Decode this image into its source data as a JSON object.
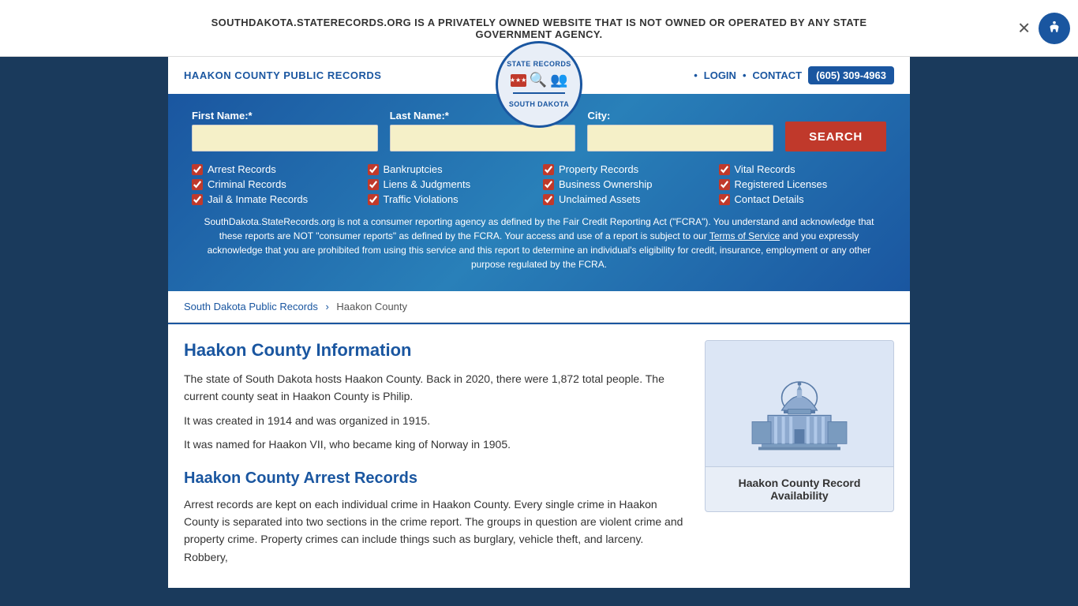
{
  "banner": {
    "text": "SOUTHDAKOTA.STATERECORDS.ORG IS A PRIVATELY OWNED WEBSITE THAT IS NOT OWNED OR OPERATED BY ANY STATE GOVERNMENT AGENCY."
  },
  "header": {
    "site_title": "HAAKON COUNTY PUBLIC RECORDS",
    "logo_top": "STATE RECORDS",
    "logo_bottom": "SOUTH DAKOTA",
    "nav": {
      "login": "LOGIN",
      "contact": "CONTACT",
      "phone": "(605) 309-4963"
    }
  },
  "search": {
    "first_name_label": "First Name:*",
    "last_name_label": "Last Name:*",
    "city_label": "City:",
    "search_button": "SEARCH",
    "checkboxes": [
      {
        "label": "Arrest Records",
        "checked": true
      },
      {
        "label": "Bankruptcies",
        "checked": true
      },
      {
        "label": "Property Records",
        "checked": true
      },
      {
        "label": "Vital Records",
        "checked": true
      },
      {
        "label": "Criminal Records",
        "checked": true
      },
      {
        "label": "Liens & Judgments",
        "checked": true
      },
      {
        "label": "Business Ownership",
        "checked": true
      },
      {
        "label": "Registered Licenses",
        "checked": true
      },
      {
        "label": "Jail & Inmate Records",
        "checked": true
      },
      {
        "label": "Traffic Violations",
        "checked": true
      },
      {
        "label": "Unclaimed Assets",
        "checked": true
      },
      {
        "label": "Contact Details",
        "checked": true
      }
    ],
    "disclaimer": "SouthDakota.StateRecords.org is not a consumer reporting agency as defined by the Fair Credit Reporting Act (\"FCRA\"). You understand and acknowledge that these reports are NOT \"consumer reports\" as defined by the FCRA. Your access and use of a report is subject to our Terms of Service and you expressly acknowledge that you are prohibited from using this service and this report to determine an individual's eligibility for credit, insurance, employment or any other purpose regulated by the FCRA."
  },
  "breadcrumb": {
    "link_text": "South Dakota Public Records",
    "separator": "›",
    "current": "Haakon County"
  },
  "main": {
    "section1_title": "Haakon County Information",
    "section1_para1": "The state of South Dakota hosts Haakon County. Back in 2020, there were 1,872 total people. The current county seat in Haakon County is Philip.",
    "section1_para2": "It was created in 1914 and was organized in 1915.",
    "section1_para3": "It was named for Haakon VII, who became king of Norway in 1905.",
    "section2_title": "Haakon County Arrest Records",
    "section2_para1": "Arrest records are kept on each individual crime in Haakon County. Every single crime in Haakon County is separated into two sections in the crime report. The groups in question are violent crime and property crime. Property crimes can include things such as burglary, vehicle theft, and larceny. Robbery,",
    "sidebar_caption": "Haakon County Record Availability"
  }
}
